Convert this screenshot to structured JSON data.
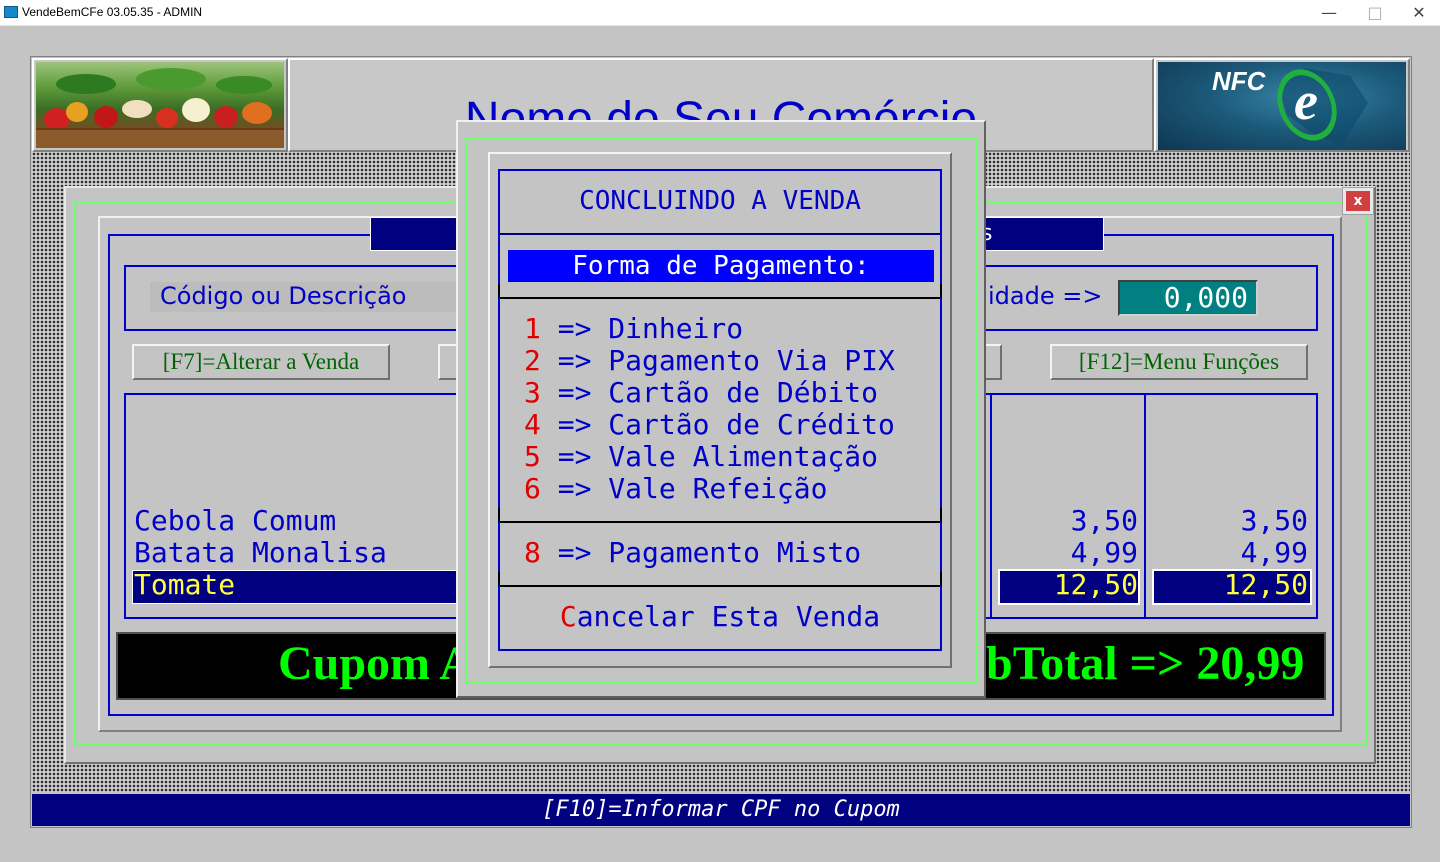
{
  "window": {
    "title": "VendeBemCFe 03.05.35 - ADMIN",
    "minimize": "—",
    "maximize": "□",
    "close": "✕"
  },
  "header": {
    "store_name": "Nome do Seu Comércio",
    "nfce_logo_text": "NFC",
    "nfce_logo_e": "e"
  },
  "sale": {
    "header_right_fragment": "s",
    "close_button": "x",
    "code_label": "Código ou Descrição",
    "qty_label": "idade =>",
    "qty_value": "0,000",
    "buttons": {
      "f7": "[F7]=Alterar a Venda",
      "f12": "[F12]=Menu Funções"
    },
    "items": [
      {
        "name": "Cebola Comum",
        "unit": "3,50",
        "total": "3,50"
      },
      {
        "name": "Batata Monalisa",
        "unit": "4,99",
        "total": "4,99"
      },
      {
        "name": "Tomate",
        "unit": "12,50",
        "total": "12,50"
      }
    ],
    "total_left": "Cupom A",
    "total_right": "bTotal => 20,99"
  },
  "footer": {
    "text": "[F10]=Informar CPF no Cupom"
  },
  "modal": {
    "title": "CONCLUINDO A VENDA",
    "pay_header": "Forma de Pagamento:",
    "options": [
      {
        "num": "1",
        "label": " => Dinheiro"
      },
      {
        "num": "2",
        "label": " => Pagamento Via PIX"
      },
      {
        "num": "3",
        "label": " => Cartão de Débito"
      },
      {
        "num": "4",
        "label": " => Cartão de Crédito"
      },
      {
        "num": "5",
        "label": " => Vale Alimentação"
      },
      {
        "num": "6",
        "label": " => Vale Refeição"
      }
    ],
    "mixed": {
      "num": "8",
      "label": " => Pagamento Misto"
    },
    "cancel_hot": "C",
    "cancel_rest": "ancelar Esta Venda"
  },
  "colors": {
    "navy": "#000080",
    "blue_text": "#0000c8",
    "hotkey_red": "#e00000",
    "total_green": "#00ff00",
    "qty_teal": "#008080"
  },
  "icons": [
    "app-icon",
    "minimize-icon",
    "maximize-icon",
    "close-icon"
  ]
}
